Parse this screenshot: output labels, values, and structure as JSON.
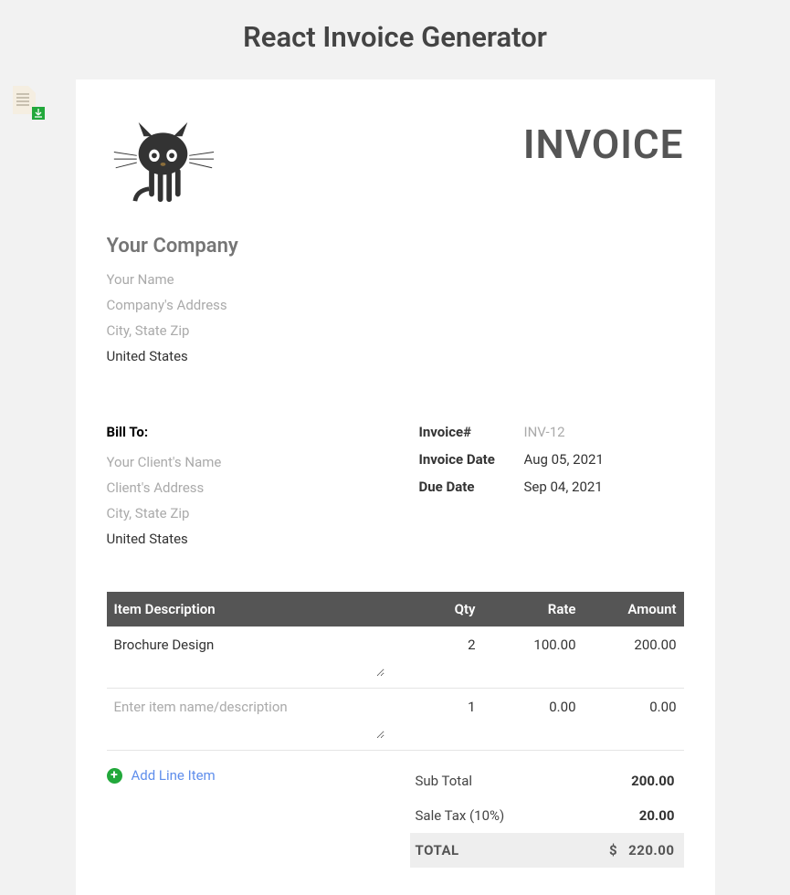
{
  "page_title": "React Invoice Generator",
  "document_label": "INVOICE",
  "company": {
    "name_placeholder": "Your Company",
    "name_value": "",
    "your_name_placeholder": "Your Name",
    "your_name_value": "",
    "address_placeholder": "Company's Address",
    "address_value": "",
    "city_placeholder": "City, State Zip",
    "city_value": "",
    "country_value": "United States"
  },
  "bill_to": {
    "label": "Bill To:",
    "client_name_placeholder": "Your Client's Name",
    "client_name_value": "",
    "client_address_placeholder": "Client's Address",
    "client_address_value": "",
    "client_city_placeholder": "City, State Zip",
    "client_city_value": "",
    "client_country_value": "United States"
  },
  "meta": {
    "invoice_no_label": "Invoice#",
    "invoice_no_placeholder": "INV-12",
    "invoice_no_value": "",
    "invoice_date_label": "Invoice Date",
    "invoice_date_value": "Aug 05, 2021",
    "due_date_label": "Due Date",
    "due_date_value": "Sep 04, 2021"
  },
  "table": {
    "headers": {
      "description": "Item Description",
      "qty": "Qty",
      "rate": "Rate",
      "amount": "Amount"
    },
    "rows": [
      {
        "description_value": "Brochure Design",
        "description_placeholder": "Enter item name/description",
        "qty": "2",
        "rate": "100.00",
        "amount": "200.00"
      },
      {
        "description_value": "",
        "description_placeholder": "Enter item name/description",
        "qty": "1",
        "rate": "0.00",
        "amount": "0.00"
      }
    ]
  },
  "add_line_label": "Add Line Item",
  "totals": {
    "subtotal_label": "Sub Total",
    "subtotal_value": "200.00",
    "tax_label": "Sale Tax (10%)",
    "tax_value": "20.00",
    "grand_label": "TOTAL",
    "currency": "$",
    "grand_value": "220.00"
  }
}
